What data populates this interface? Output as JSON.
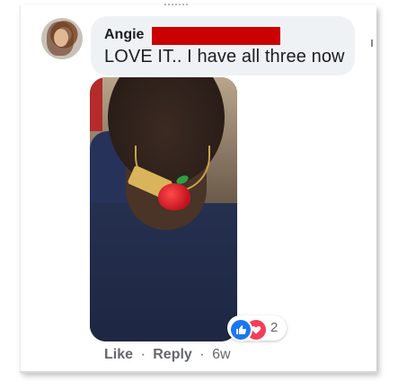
{
  "comment": {
    "author": "Angie",
    "text": "LOVE IT.. I have all three now",
    "reactions": {
      "icons": [
        "like-icon",
        "love-icon"
      ],
      "count": "2"
    },
    "actions": {
      "like_label": "Like",
      "separator": "·",
      "reply_label": "Reply",
      "time": "6w"
    }
  },
  "colors": {
    "bubble": "#eff2f5",
    "text": "#1c1e21",
    "secondary": "#65676b",
    "like_blue": "#1877f2",
    "love_red": "#f33e58",
    "redaction": "#cc0000"
  }
}
